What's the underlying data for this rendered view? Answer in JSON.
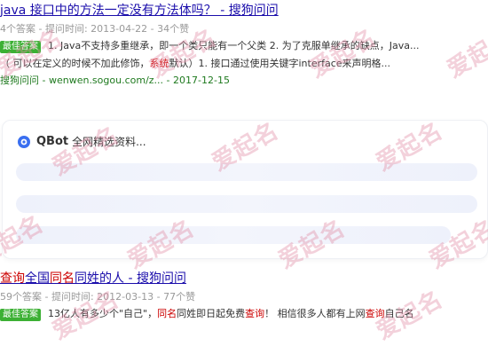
{
  "result1": {
    "title_parts": [
      {
        "text": "java 接口中的方法一定没有方法体吗？ - 搜狗问问",
        "hl": false
      }
    ],
    "answers_count": "4个答案",
    "time_label": "提问时间: 2013-04-22",
    "likes": "34个赞",
    "best_label": "最佳答案",
    "answer_line1_parts": [
      {
        "text": "1. Java不支持多重继承，即一个类只能有一个父类 2. 为了克服单继承的缺点，Java...",
        "hl": false
      }
    ],
    "answer_line2_parts": [
      {
        "text": "（ 可以在定义的时候不加此修饰，",
        "hl": false
      },
      {
        "text": "系统",
        "hl": true
      },
      {
        "text": "默认）1. 接口通过使用关键字interface来声明格...",
        "hl": false
      }
    ],
    "source_name": "搜狗问问",
    "source_url": "wenwen.sogou.com/z...",
    "source_date": "2017-12-15"
  },
  "qbot": {
    "name": "QBot",
    "status": "全网精选资料..."
  },
  "result2": {
    "title_parts": [
      {
        "text": "查询",
        "hl": true
      },
      {
        "text": "全国",
        "hl": false
      },
      {
        "text": "同名",
        "hl": true
      },
      {
        "text": "同姓的人 - 搜狗问问",
        "hl": false
      }
    ],
    "answers_count": "59个答案",
    "time_label": "提问时间: 2012-03-13",
    "likes": "77个赞",
    "best_label": "最佳答案",
    "answer_line1_parts": [
      {
        "text": "13亿人有多少个\"自己\"，",
        "hl": false
      },
      {
        "text": "同名",
        "hl": true
      },
      {
        "text": "同姓即日起免费",
        "hl": false
      },
      {
        "text": "查询",
        "hl": true
      },
      {
        "text": "！ 相信很多人都有上网",
        "hl": false
      },
      {
        "text": "查询",
        "hl": true
      },
      {
        "text": "自己名",
        "hl": false
      }
    ]
  },
  "watermark": {
    "text": "爱起名"
  }
}
